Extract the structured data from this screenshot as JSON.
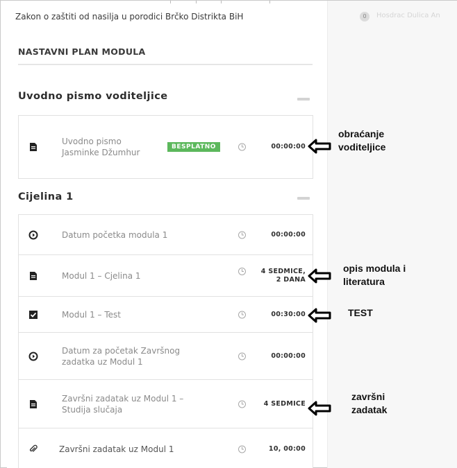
{
  "course_title": "Zakon o zaštiti od nasilja u porodici Brčko Distrikta BiH",
  "right_panel": {
    "count": "0",
    "faded_text": "Hosdrac Dulica An"
  },
  "plan_title": "NASTAVNI PLAN MODULA",
  "sections": [
    {
      "title": "Uvodno pismo voditeljice",
      "lessons": [
        {
          "icon": "document-icon",
          "title": "Uvodno pismo Jasminke Džumhur",
          "badge": "BESPLATNO",
          "duration": "00:00:00"
        }
      ]
    },
    {
      "title": "Cijelina 1",
      "lessons": [
        {
          "icon": "play-circle-icon",
          "title": "Datum početka modula 1",
          "duration": "00:00:00"
        },
        {
          "icon": "document-icon",
          "title": "Modul 1 – Cjelina 1",
          "duration_line1": "4 SEDMICE,",
          "duration_line2": "2 DANA"
        },
        {
          "icon": "quiz-check-icon",
          "title": "Modul 1 – Test",
          "duration": "00:30:00"
        },
        {
          "icon": "play-circle-icon",
          "title": "Datum za početak Završnog zadatka uz Modul 1",
          "duration": "00:00:00"
        },
        {
          "icon": "document-icon",
          "title": "Završni zadatak uz Modul 1 – Studija slučaja",
          "duration": "4 SEDMICE"
        },
        {
          "icon": "paperclip-icon",
          "title": "Završni zadatak uz Modul 1",
          "duration": "10, 00:00"
        }
      ]
    }
  ],
  "annotations": {
    "voditeljice_line1": "obraćanje",
    "voditeljice_line2": "voditeljice",
    "opis_line1": "opis modula i",
    "opis_line2": "literatura",
    "test": "TEST",
    "zavrsni_line1": "završni",
    "zavrsni_line2": "zadatak"
  }
}
